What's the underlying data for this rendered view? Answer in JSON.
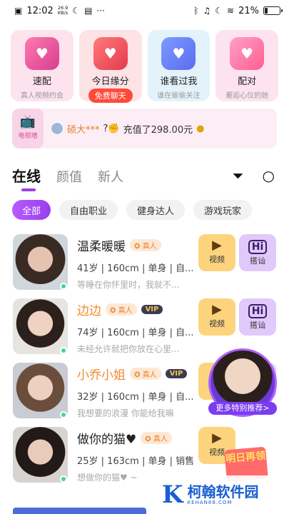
{
  "status_bar": {
    "time": "12:02",
    "net_speed": "26.9",
    "net_unit": "KB/s",
    "battery": "21%",
    "battery_level": 0.21
  },
  "feature_cards": [
    {
      "title": "速配",
      "subtitle": "真人视频约会"
    },
    {
      "title": "今日缘分",
      "button": "免费聊天"
    },
    {
      "title": "谁看过我",
      "subtitle": "谁在偷偷关注"
    },
    {
      "title": "配对",
      "subtitle": "邂逅心仪的她"
    }
  ],
  "banner": {
    "tv_label": "电视墙",
    "user": "硕大***",
    "message": "充值了298.00元"
  },
  "tabs": [
    "在线",
    "颜值",
    "新人"
  ],
  "chips": [
    "全部",
    "自由职业",
    "健身达人",
    "游戏玩家"
  ],
  "profiles": [
    {
      "name": "温柔暖暖",
      "verified": "真人",
      "meta": "41岁 | 160cm | 单身 | 自...",
      "signature": "等睡在你怀里时，我就不..."
    },
    {
      "name": "边边",
      "verified": "真人",
      "vip": "VIP",
      "meta": "74岁 | 160cm | 单身 | 自...",
      "signature": "未经允许就把你放在心里..."
    },
    {
      "name": "小乔小姐",
      "verified": "真人",
      "vip": "VIP",
      "meta": "32岁 | 160cm | 单身 | 自...",
      "signature": "我想要的浪漫 你能给我嘛"
    },
    {
      "name": "做你的猫♥",
      "verified": "真人",
      "meta": "25岁 | 163cm | 单身 | 销售",
      "signature": "想做你的猫♥ ~"
    }
  ],
  "actions": {
    "video": "视频",
    "chat": "搭讪",
    "chat_icon": "Hi"
  },
  "floating_label": "更多特别推荐>",
  "promo": "明日再领",
  "watermark": {
    "name": "柯翰软件园",
    "url": "KEHAN88.COM"
  },
  "colors": {
    "accent": "#9b3ef0",
    "highlight_name": "#f08a2c",
    "online": "#3ed6a3"
  }
}
